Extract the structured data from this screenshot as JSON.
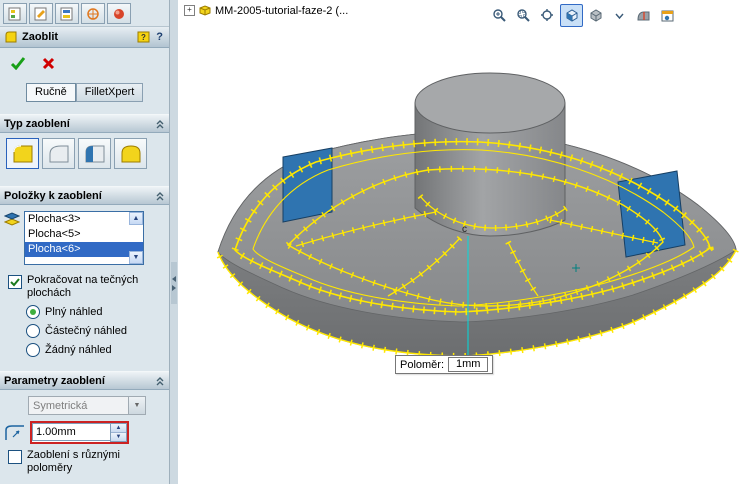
{
  "tree": {
    "node": "MM-2005-tutorial-faze-2 (..."
  },
  "pm": {
    "title": "Zaoblit",
    "help": "?",
    "tab_manual": "Ručně",
    "tab_expert": "FilletXpert",
    "sec_type": "Typ zaoblení",
    "sec_items": "Položky k zaoblení",
    "sec_params": "Parametry zaoblení",
    "items": [
      "Plocha<3>",
      "Plocha<5>",
      "Plocha<6>"
    ],
    "selected_item": "Plocha<6>",
    "chk_tangent": "Pokračovat na tečných plochách",
    "radio_full": "Plný náhled",
    "radio_partial": "Částečný náhled",
    "radio_none": "Žádný náhled",
    "symmetric": "Symetrická",
    "radius": "1.00mm",
    "chk_multi": "Zaoblení s různými poloměry"
  },
  "viewport": {
    "callout_label": "Poloměr:",
    "callout_value": "1mm",
    "vertex": "c"
  },
  "colors": {
    "edge_preview": "#ffe800",
    "selected_face": "#2f74b0",
    "selection_blue": "#316ac5",
    "annotation_red": "#cc2222",
    "leader_cyan": "#00dcdc",
    "model_gray": "#8f9193"
  }
}
